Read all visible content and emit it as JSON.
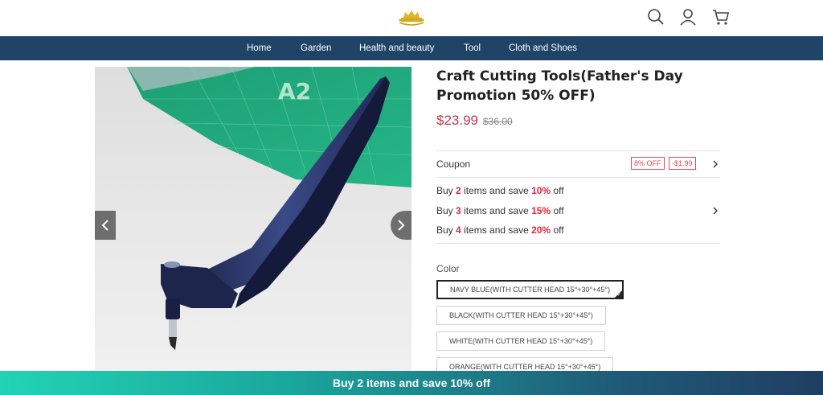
{
  "header": {
    "logo_icon": "crown-logo",
    "icons": [
      "search-icon",
      "user-icon",
      "cart-icon"
    ]
  },
  "nav": {
    "items": [
      {
        "label": "Home"
      },
      {
        "label": "Garden"
      },
      {
        "label": "Health and beauty"
      },
      {
        "label": "Tool"
      },
      {
        "label": "Cloth and Shoes"
      }
    ]
  },
  "gallery": {
    "image_icon": "craft-cutting-tool-photo",
    "mat_label": "A2",
    "prev_icon": "chevron-left-icon",
    "next_icon": "chevron-right-icon"
  },
  "product": {
    "title_line1": "Craft Cutting Tools(Father's Day",
    "title_line2": "Promotion 50% OFF)",
    "price": "$23.99",
    "original_price": "$36.00"
  },
  "coupon": {
    "label": "Coupon",
    "tag_percent": "8% OFF",
    "tag_amount": "-$1.99"
  },
  "bundles": [
    {
      "pre": "Buy ",
      "qty": "2",
      "mid": " items and save ",
      "pct": "10%",
      "post": " off"
    },
    {
      "pre": "Buy ",
      "qty": "3",
      "mid": " items and save ",
      "pct": "15%",
      "post": " off"
    },
    {
      "pre": "Buy ",
      "qty": "4",
      "mid": " items and save ",
      "pct": "20%",
      "post": " off"
    }
  ],
  "color": {
    "label": "Color",
    "options": [
      {
        "label": "NAVY BLUE(WITH CUTTER HEAD 15°+30°+45°)",
        "selected": true
      },
      {
        "label": "BLACK(WITH CUTTER HEAD 15°+30°+45°)",
        "selected": false
      },
      {
        "label": "WHITE(WITH CUTTER HEAD 15°+30°+45°)",
        "selected": false
      },
      {
        "label": "ORANGE(WITH CUTTER HEAD 15°+30°+45°)",
        "selected": false
      }
    ]
  },
  "promo_bar": {
    "text": "Buy 2 items and save 10% off"
  },
  "colors": {
    "nav_bg": "#1f4468",
    "price": "#c0394b",
    "highlight": "#e0283b",
    "promo_start": "#22d3b4",
    "promo_end": "#1f3e62"
  }
}
